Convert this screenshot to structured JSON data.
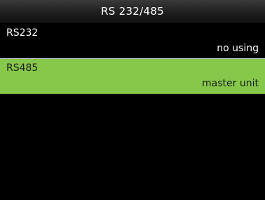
{
  "header": {
    "title": "RS 232/485"
  },
  "menu": {
    "items": [
      {
        "label": "RS232",
        "value": "no using",
        "selected": false
      },
      {
        "label": "RS485",
        "value": "master unit",
        "selected": true
      }
    ]
  },
  "colors": {
    "background": "#000000",
    "selected_background": "#86c84a",
    "text": "#ffffff",
    "selected_text": "#1c1c1c"
  }
}
